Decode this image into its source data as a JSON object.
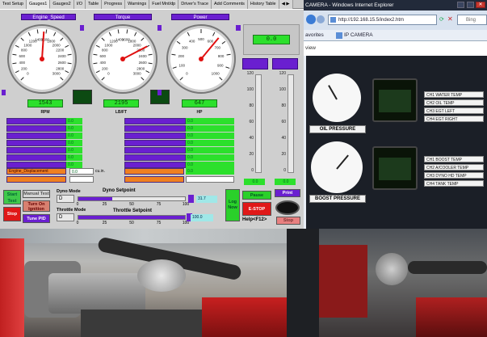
{
  "tabs": [
    "Test Setup",
    "Gauges1",
    "Gauges2",
    "I/O",
    "Table",
    "Progress",
    "Warnings",
    "Fuel Mnt/dp",
    "Driver's Trace",
    "Add Comments",
    "History Table"
  ],
  "active_tab": "Gauges1",
  "gauges": [
    {
      "title": "Engine_Speed",
      "value": "1543",
      "unit": "RPM",
      "ticks": [
        "600",
        "800",
        "1000",
        "1200",
        "1400",
        "1600",
        "1800",
        "2000",
        "2200",
        "400",
        "200",
        "0",
        "2400",
        "2600",
        "2800",
        "3000"
      ]
    },
    {
      "title": "Torque",
      "value": "2195",
      "unit": "LB/FT",
      "ticks": [
        "600",
        "800",
        "1000",
        "1200",
        "1400",
        "1600",
        "1800",
        "2000",
        "2200",
        "400",
        "200",
        "0",
        "2400",
        "2600",
        "2800",
        "3000"
      ]
    },
    {
      "title": "Power",
      "value": "647",
      "unit": "HP",
      "ticks": [
        "200",
        "300",
        "400",
        "500",
        "600",
        "700",
        "800",
        "100",
        "0",
        "900",
        "1000"
      ]
    }
  ],
  "top_display": "0.0",
  "right_scale": [
    "120",
    "100",
    "80",
    "60",
    "40",
    "20",
    "0"
  ],
  "right_values": [
    "0.0",
    "0.0"
  ],
  "left_rows": [
    "0.0",
    "0.0",
    "0.0",
    "0.0",
    "0.0",
    "0.0",
    "0.0"
  ],
  "mid_rows": [
    "0.0",
    "0.0",
    "0.0",
    "0.0",
    "0.0",
    "0.0",
    "0.0"
  ],
  "displacement_label": "Engine_Displacement",
  "displacement_value": "0.0",
  "displacement_unit": "cu.in.",
  "mid_orange_value": "0.0",
  "controls": {
    "start_test": "Start Test",
    "manual_test": "Manual Test",
    "turn_on_ignition": "Turn On Ignition",
    "stop": "Stop",
    "tune_pid": "Tune PID",
    "dyno_mode_label": "Dyno Mode",
    "dyno_mode_value": "D",
    "dyno_setpoint_label": "Dyno Setpoint",
    "dyno_setpoint_value": "31.7",
    "throttle_mode_label": "Throttle Mode",
    "throttle_mode_value": "D",
    "throttle_setpoint_label": "Throttle Setpoint",
    "throttle_setpoint_value": "100.0",
    "slider_ticks": [
      "0",
      "25",
      "50",
      "75",
      "100"
    ],
    "log_now": "Log Now",
    "pause": "Pause",
    "estop": "E-STOP",
    "help": "Help<F12>",
    "print": "Print",
    "stop_btn": "Stop"
  },
  "dyno_setpoint_fraction": 0.32,
  "throttle_setpoint_fraction": 1.0,
  "browser": {
    "title": "CAMERA - Windows Internet Explorer",
    "url": "http://192.168.15.5/index2.htm",
    "search_placeholder": "Bing",
    "favorites": "avorites",
    "tab": "IP CAMERA",
    "view": "view"
  },
  "camera_labels": {
    "oil_pressure": "OIL PRESSURE",
    "boost_pressure": "BOOST PRESSURE",
    "ch_top": [
      "CH1  WATER TEMP",
      "CH2  OIL TEMP",
      "CH3  EGT LEFT",
      "CH4  EGT RIGHT"
    ],
    "ch_bottom": [
      "CH1  BOOST TEMP",
      "CH2  A/COOLER TEMP",
      "CH3  DYNO HD TEMP",
      "CH4  TANK TEMP"
    ]
  }
}
